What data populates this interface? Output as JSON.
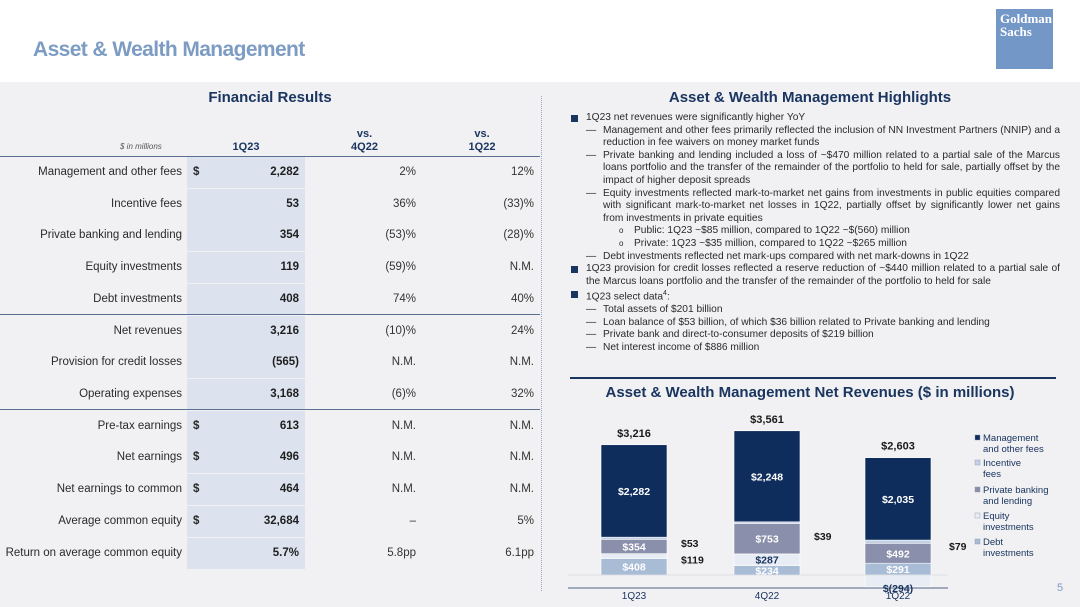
{
  "page": {
    "title": "Asset & Wealth Management",
    "logo_line1": "Goldman",
    "logo_line2": "Sachs",
    "page_number": "5"
  },
  "financial": {
    "title": "Financial Results",
    "units": "$ in millions",
    "col1": "1Q23",
    "col2_a": "vs.",
    "col2_b": "4Q22",
    "col3_a": "vs.",
    "col3_b": "1Q22",
    "rows": [
      {
        "label": "Management and other fees",
        "dollar": "$",
        "v": "2,282",
        "q": "2%",
        "y": "12%"
      },
      {
        "label": "Incentive fees",
        "dollar": "",
        "v": "53",
        "q": "36%",
        "y": "(33)%"
      },
      {
        "label": "Private banking and lending",
        "dollar": "",
        "v": "354",
        "q": "(53)%",
        "y": "(28)%"
      },
      {
        "label": "Equity investments",
        "dollar": "",
        "v": "119",
        "q": "(59)%",
        "y": "N.M."
      },
      {
        "label": "Debt investments",
        "dollar": "",
        "v": "408",
        "q": "74%",
        "y": "40%"
      },
      {
        "label": "Net revenues",
        "dollar": "",
        "v": "3,216",
        "q": "(10)%",
        "y": "24%"
      },
      {
        "label": "Provision for credit losses",
        "dollar": "",
        "v": "(565)",
        "q": "N.M.",
        "y": "N.M."
      },
      {
        "label": "Operating expenses",
        "dollar": "",
        "v": "3,168",
        "q": "(6)%",
        "y": "32%"
      },
      {
        "label": "Pre-tax earnings",
        "dollar": "$",
        "v": "613",
        "q": "N.M.",
        "y": "N.M."
      },
      {
        "label": "Net earnings",
        "dollar": "$",
        "v": "496",
        "q": "N.M.",
        "y": "N.M."
      },
      {
        "label": "Net earnings to common",
        "dollar": "$",
        "v": "464",
        "q": "N.M.",
        "y": "N.M."
      },
      {
        "label": "Average common equity",
        "dollar": "$",
        "v": "32,684",
        "q": "–",
        "y": "5%"
      },
      {
        "label": "Return on average common equity",
        "dollar": "",
        "v": "5.7%",
        "q": "5.8pp",
        "y": "6.1pp"
      }
    ]
  },
  "highlights": {
    "title": "Asset & Wealth Management Highlights",
    "b1": "1Q23 net revenues were significantly higher YoY",
    "b1_s1": "Management and other fees primarily reflected the inclusion of NN Investment Partners (NNIP) and a reduction in fee waivers on money market funds",
    "b1_s2": "Private banking and lending included a loss of ~$470 million related to a partial sale of the Marcus loans portfolio and the transfer of the remainder of the portfolio to held for sale, partially offset by the impact of higher deposit spreads",
    "b1_s3": "Equity investments reflected mark-to-market net gains from investments in public equities compared with significant mark-to-market net losses in 1Q22, partially offset by significantly lower net gains from investments in private equities",
    "b1_s3_a": "Public: 1Q23 ~$85 million, compared to 1Q22 ~$(560) million",
    "b1_s3_b": "Private: 1Q23 ~$35 million, compared to 1Q22 ~$265 million",
    "b1_s4": "Debt investments reflected net mark-ups compared with net mark-downs in 1Q22",
    "b2": "1Q23 provision for credit losses reflected a reserve reduction of ~$440 million related to a partial sale of the Marcus loans portfolio and the transfer of the remainder of the portfolio to held for sale",
    "b3": "1Q23 select data",
    "b3_sup": "4",
    "b3_suffix": ":",
    "b3_s1": "Total assets of $201 billion",
    "b3_s2": "Loan balance of $53 billion, of which $36 billion related to Private banking and lending",
    "b3_s3": "Private bank and direct-to-consumer deposits of $219 billion",
    "b3_s4": "Net interest income of $886 million",
    "dash": "—",
    "circle": "o"
  },
  "chart_data": {
    "type": "bar",
    "title": "Asset & Wealth Management Net Revenues ($ in millions)",
    "categories": [
      "1Q23",
      "4Q22",
      "1Q22"
    ],
    "totals": [
      "$3,216",
      "$3,561",
      "$2,603"
    ],
    "series": [
      {
        "name": "Management and other fees",
        "color": "#0f2d5c",
        "values": [
          2282,
          2248,
          2035
        ],
        "labels": [
          "$2,282",
          "$2,248",
          "$2,035"
        ]
      },
      {
        "name": "Incentive fees",
        "color": "#c3d1e6",
        "values": [
          53,
          39,
          79
        ],
        "labels": [
          "$53",
          "$39",
          "$79"
        ]
      },
      {
        "name": "Private banking and lending",
        "color": "#8a8fab",
        "values": [
          354,
          753,
          492
        ],
        "labels": [
          "$354",
          "$753",
          "$492"
        ]
      },
      {
        "name": "Equity investments",
        "color": "#e8ecf4",
        "values": [
          119,
          287,
          -294
        ],
        "labels": [
          "$119",
          "$287",
          "$(294)"
        ]
      },
      {
        "name": "Debt investments",
        "color": "#a8bcd6",
        "values": [
          408,
          234,
          291
        ],
        "labels": [
          "$408",
          "$234",
          "$291"
        ]
      }
    ],
    "legend_position": "right"
  }
}
